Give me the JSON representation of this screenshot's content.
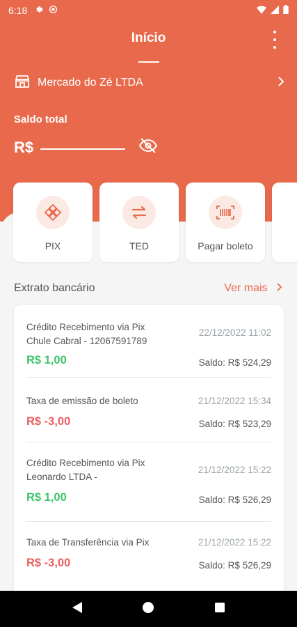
{
  "status": {
    "time": "6:18"
  },
  "header": {
    "title": "Início"
  },
  "store": {
    "name": "Mercado do Zé LTDA"
  },
  "balance": {
    "label": "Saldo total",
    "currency": "R$"
  },
  "actions": [
    {
      "label": "PIX",
      "icon": "pix-icon"
    },
    {
      "label": "TED",
      "icon": "transfer-icon"
    },
    {
      "label": "Pagar boleto",
      "icon": "barcode-icon"
    }
  ],
  "statement": {
    "title": "Extrato bancário",
    "more": "Ver mais",
    "items": [
      {
        "desc": "Crédito Recebimento via Pix Chule Cabral - 12067591789",
        "date": "22/12/2022 11:02",
        "amount": "R$ 1,00",
        "type": "positive",
        "balance": "Saldo: R$ 524,29"
      },
      {
        "desc": "Taxa de emissão de boleto",
        "date": "21/12/2022 15:34",
        "amount": "R$ -3,00",
        "type": "negative",
        "balance": "Saldo: R$ 523,29"
      },
      {
        "desc": "Crédito Recebimento via Pix Leonardo LTDA -",
        "date": "21/12/2022 15:22",
        "amount": "R$ 1,00",
        "type": "positive",
        "balance": "Saldo: R$ 526,29"
      },
      {
        "desc": "Taxa de Transferência via Pix",
        "date": "21/12/2022 15:22",
        "amount": "R$ -3,00",
        "type": "negative",
        "balance": "Saldo: R$ 526,29"
      }
    ]
  },
  "colors": {
    "primary": "#e8694b",
    "positive": "#3cc46a",
    "negative": "#ec5e5e"
  }
}
